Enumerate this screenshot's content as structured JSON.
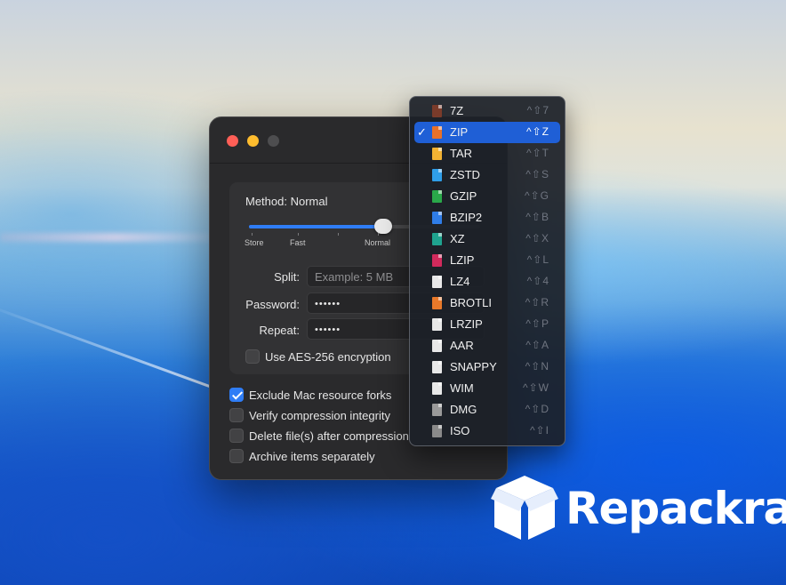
{
  "window": {
    "method_label": "Method: Normal",
    "method_level": 0.58,
    "speed_labels": [
      "Store",
      "Fast",
      "Normal"
    ],
    "split_label": "Split:",
    "split_placeholder": "Example: 5 MB",
    "password_label": "Password:",
    "password_value": "••••••",
    "repeat_label": "Repeat:",
    "repeat_value": "••••••",
    "aes_label": "Use AES-256 encryption",
    "aes_checked": false,
    "options": [
      {
        "label": "Exclude Mac resource forks",
        "checked": true
      },
      {
        "label": "Verify compression integrity",
        "checked": false
      },
      {
        "label": "Delete file(s) after compression",
        "checked": false
      },
      {
        "label": "Archive items separately",
        "checked": false
      }
    ]
  },
  "format_menu": {
    "selected_mark": "✓",
    "items": [
      {
        "name": "7Z",
        "shortcut": "^⇧7",
        "color": "#7a3b2a",
        "selected": false
      },
      {
        "name": "ZIP",
        "shortcut": "^⇧Z",
        "color": "#e8712a",
        "selected": true
      },
      {
        "name": "TAR",
        "shortcut": "^⇧T",
        "color": "#f2b233",
        "selected": false
      },
      {
        "name": "ZSTD",
        "shortcut": "^⇧S",
        "color": "#2f9ee8",
        "selected": false
      },
      {
        "name": "GZIP",
        "shortcut": "^⇧G",
        "color": "#2aa84a",
        "selected": false
      },
      {
        "name": "BZIP2",
        "shortcut": "^⇧B",
        "color": "#2f7de8",
        "selected": false
      },
      {
        "name": "XZ",
        "shortcut": "^⇧X",
        "color": "#1fa38f",
        "selected": false
      },
      {
        "name": "LZIP",
        "shortcut": "^⇧L",
        "color": "#d12a5c",
        "selected": false
      },
      {
        "name": "LZ4",
        "shortcut": "^⇧4",
        "color": "#e8e8e8",
        "selected": false
      },
      {
        "name": "BROTLI",
        "shortcut": "^⇧R",
        "color": "#e8792a",
        "selected": false
      },
      {
        "name": "LRZIP",
        "shortcut": "^⇧P",
        "color": "#e8e8e8",
        "selected": false
      },
      {
        "name": "AAR",
        "shortcut": "^⇧A",
        "color": "#e8e8e8",
        "selected": false
      },
      {
        "name": "SNAPPY",
        "shortcut": "^⇧N",
        "color": "#e8e8e8",
        "selected": false
      },
      {
        "name": "WIM",
        "shortcut": "^⇧W",
        "color": "#e8e8e8",
        "selected": false
      },
      {
        "name": "DMG",
        "shortcut": "^⇧D",
        "color": "#9a9a9a",
        "selected": false
      },
      {
        "name": "ISO",
        "shortcut": "^⇧I",
        "color": "#8a8a8a",
        "selected": false
      }
    ]
  },
  "watermark": {
    "text": "Repackra",
    "icon": "box-icon"
  }
}
